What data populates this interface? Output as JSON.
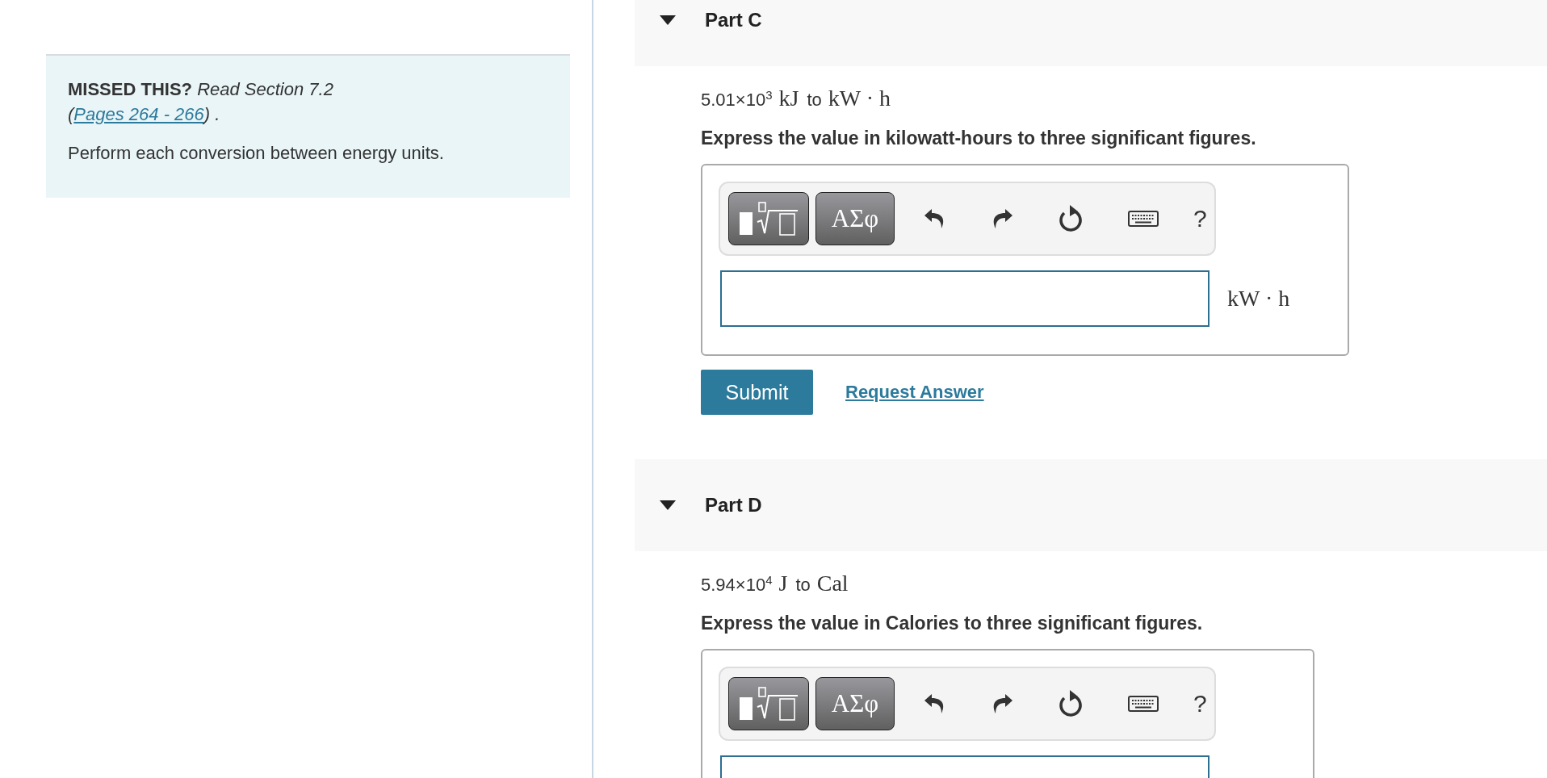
{
  "hint": {
    "label": "MISSED THIS?",
    "text_before": "Read Section 7.2 (",
    "link": "Pages 264 - 266",
    "text_after": ") .",
    "instructions": "Perform each conversion between energy units."
  },
  "parts": [
    {
      "title": "Part C",
      "expanded": true,
      "value": "5.01×10$^{3}$",
      "from_unit": "kJ",
      "to": "to",
      "to_unit": "kW · h",
      "prompt": "Express the value in kilowatt-hours to three significant figures.",
      "toolbar": {
        "symbols": "ΑΣφ",
        "help": "?"
      },
      "answer_unit": "kW · h",
      "submit": "Submit",
      "request": "Request Answer"
    },
    {
      "title": "Part D",
      "expanded": true,
      "value": "5.94×10$^{4}$",
      "from_unit": "J",
      "to": "to",
      "to_unit": "Cal",
      "prompt": "Express the value in Calories to three significant figures.",
      "toolbar": {
        "symbols": "ΑΣφ",
        "help": "?"
      }
    }
  ]
}
